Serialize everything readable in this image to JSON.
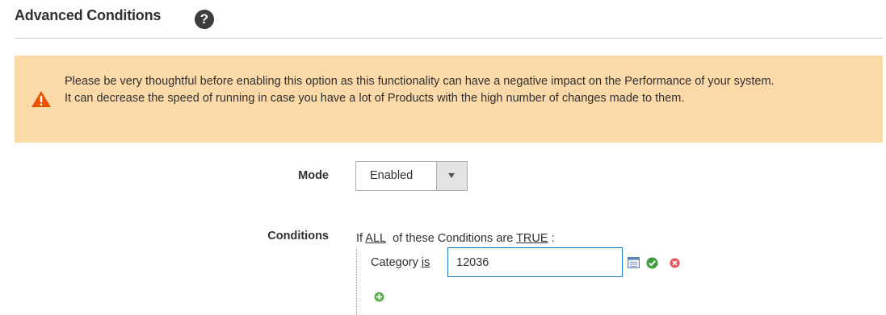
{
  "section": {
    "title": "Advanced Conditions",
    "help_icon": "question-icon"
  },
  "notice": {
    "icon": "warning-icon",
    "color": "#fbd9a9",
    "line1": "Please be very thoughtful before enabling this option as this functionality can have a negative impact on the Performance of your system.",
    "line2": "It can decrease the speed of running in case you have a lot of Products with the high number of changes made to them."
  },
  "mode": {
    "label": "Mode",
    "value": "Enabled"
  },
  "conditions": {
    "label": "Conditions",
    "prefix": "If",
    "aggregator": "ALL",
    "middle": "of these Conditions are",
    "value": "TRUE",
    "suffix": ":",
    "rule": {
      "attribute": "Category",
      "operator": "is",
      "input_value": "12036"
    }
  },
  "colors": {
    "accent": "#1979c3",
    "text": "#303030"
  }
}
